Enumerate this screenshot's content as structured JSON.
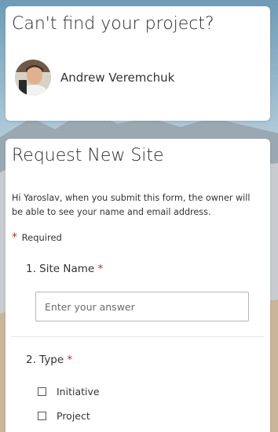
{
  "help_card": {
    "title": "Can't find your project?",
    "owner_name": "Andrew Veremchuk"
  },
  "form": {
    "title": "Request New Site",
    "notice": "Hi Yaroslav, when you submit this form, the owner will be able to see your name and email address.",
    "required_star": "*",
    "required_label": "Required",
    "questions": [
      {
        "label": "1. Site Name",
        "required_star": "*",
        "placeholder": "Enter your answer"
      },
      {
        "label": "2. Type",
        "required_star": "*",
        "options": [
          "Initiative",
          "Project"
        ]
      }
    ]
  },
  "colors": {
    "required": "#c4262e",
    "card": "#ffffff"
  }
}
